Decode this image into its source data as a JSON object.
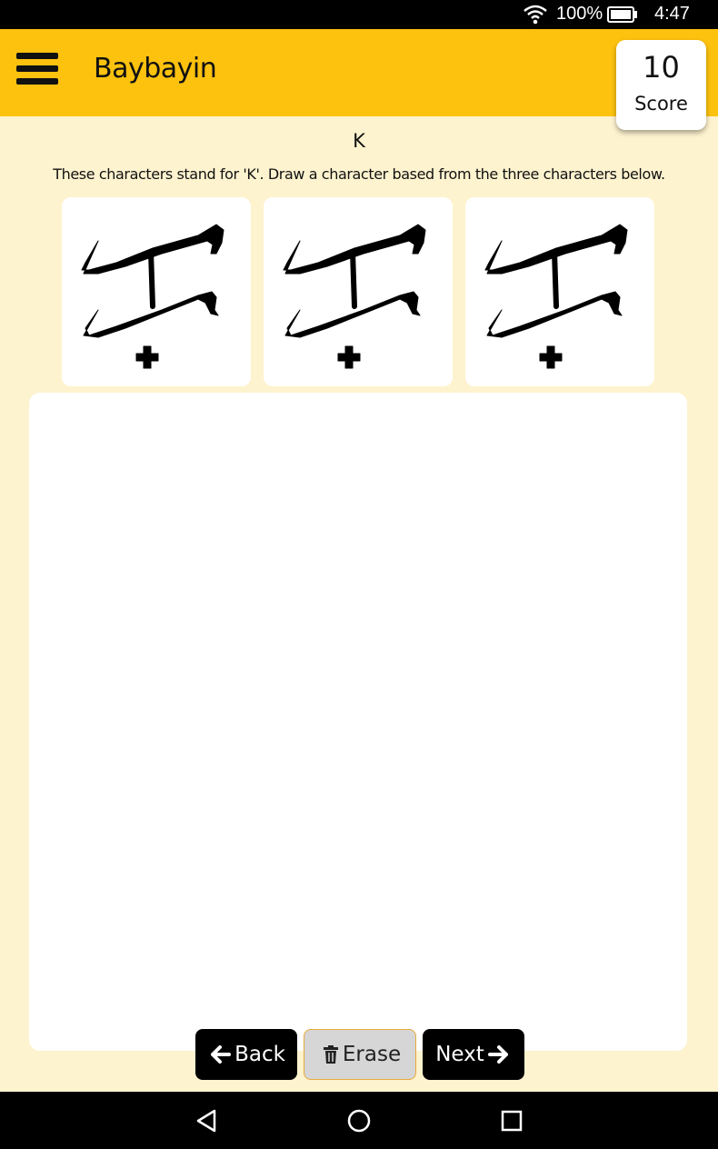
{
  "status_bar": {
    "battery_percent": "100%",
    "time": "4:47",
    "icons": [
      "wifi-icon",
      "battery-icon"
    ]
  },
  "app_bar": {
    "title": "Baybayin",
    "menu_icon": "hamburger-menu-icon"
  },
  "score": {
    "value": "10",
    "label": "Score"
  },
  "prompt": {
    "letter": "K",
    "instructions": "These characters stand for 'K'. Draw a character based from the three characters below."
  },
  "samples": {
    "count": 3,
    "glyph": "baybayin-ka-with-plus-virama"
  },
  "buttons": {
    "back": "Back",
    "erase": "Erase",
    "next": "Next"
  },
  "icons": {
    "back": "arrow-left-icon",
    "erase": "trash-icon",
    "next": "arrow-right-icon"
  },
  "nav_bar": {
    "icons": [
      "back-triangle-icon",
      "home-circle-icon",
      "recents-square-icon"
    ]
  },
  "colors": {
    "app_bar": "#fdc20e",
    "background": "#fef3cf",
    "button_dark": "#000000",
    "erase_button": "#d6d6d6"
  }
}
